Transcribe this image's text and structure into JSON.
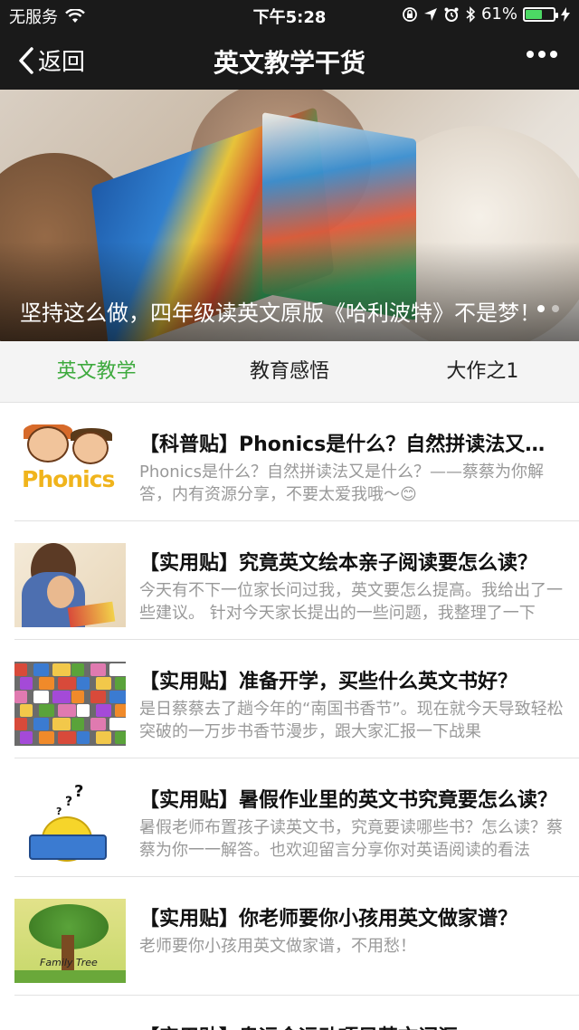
{
  "status_bar": {
    "carrier": "无服务",
    "time": "下午5:28",
    "battery": "61%",
    "battery_level": 0.61
  },
  "nav": {
    "back_label": "返回",
    "title": "英文教学干货"
  },
  "banner": {
    "caption": "坚持这么做，四年级读英文原版《哈利波特》不是梦！"
  },
  "tabs": [
    {
      "label": "英文教学",
      "active": true
    },
    {
      "label": "教育感悟",
      "active": false
    },
    {
      "label": "大作之1",
      "active": false
    }
  ],
  "articles": [
    {
      "title": "【科普贴】Phonics是什么？自然拼读法又是什么？",
      "desc": "Phonics是什么？自然拼读法又是什么？——蔡蔡为你解答，内有资源分享，不要太爱我哦～😊",
      "thumb_word": "Phonics"
    },
    {
      "title": "【实用贴】究竟英文绘本亲子阅读要怎么读？",
      "desc": "今天有不下一位家长问过我，英文要怎么提高。我给出了一些建议。 针对今天家长提出的一些问题，我整理了一下"
    },
    {
      "title": "【实用贴】准备开学，买些什么英文书好？",
      "desc": "是日蔡蔡去了趟今年的“南国书香节”。现在就今天导致轻松突破的一万步书香节漫步，跟大家汇报一下战果"
    },
    {
      "title": "【实用贴】暑假作业里的英文书究竟要怎么读？",
      "desc": "暑假老师布置孩子读英文书，究竟要读哪些书？怎么读？蔡蔡为你一一解答。也欢迎留言分享你对英语阅读的看法"
    },
    {
      "title": "【实用贴】你老师要你小孩用英文做家谱？",
      "desc": "老师要你小孩用英文做家谱，不用愁！",
      "thumb_text_1": "Family",
      "thumb_text_2": "Tree"
    },
    {
      "title": "【实用贴】奥运会运动项目英文词汇",
      "desc": ""
    }
  ]
}
